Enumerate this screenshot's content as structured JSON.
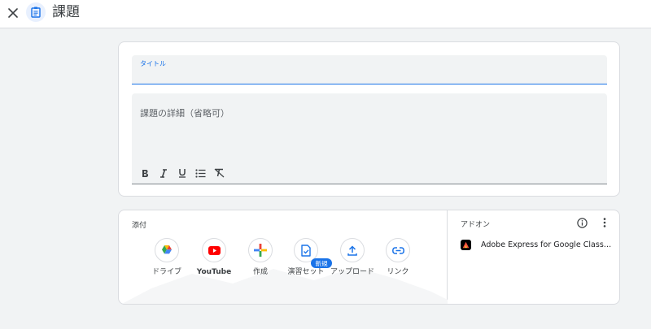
{
  "header": {
    "title": "課題",
    "close_icon": "close-icon",
    "assignment_icon": "assignment-icon"
  },
  "form": {
    "title_label": "タイトル",
    "title_value": "",
    "description_placeholder": "課題の詳細（省略可）",
    "format_tools": [
      "bold-icon",
      "italic-icon",
      "underline-icon",
      "bulleted-list-icon",
      "clear-formatting-icon"
    ]
  },
  "attachments": {
    "label": "添付",
    "items": [
      {
        "label": "ドライブ",
        "icon": "google-drive-icon"
      },
      {
        "label": "YouTube",
        "icon": "youtube-icon"
      },
      {
        "label": "作成",
        "icon": "create-plus-icon"
      },
      {
        "label": "演習セット",
        "icon": "practice-set-icon"
      },
      {
        "label": "アップロード",
        "icon": "upload-icon"
      },
      {
        "label": "リンク",
        "icon": "link-icon"
      }
    ],
    "new_badge": "新規"
  },
  "addons": {
    "label": "アドオン",
    "items": [
      {
        "name": "Adobe Express for Google Classroom",
        "icon": "adobe-express-icon"
      }
    ]
  },
  "colors": {
    "accent": "#1a73e8",
    "background": "#f1f3f4",
    "youtube_red": "#ff0000",
    "google_green": "#34a853",
    "google_yellow": "#fbbc04",
    "google_red": "#ea4335"
  }
}
